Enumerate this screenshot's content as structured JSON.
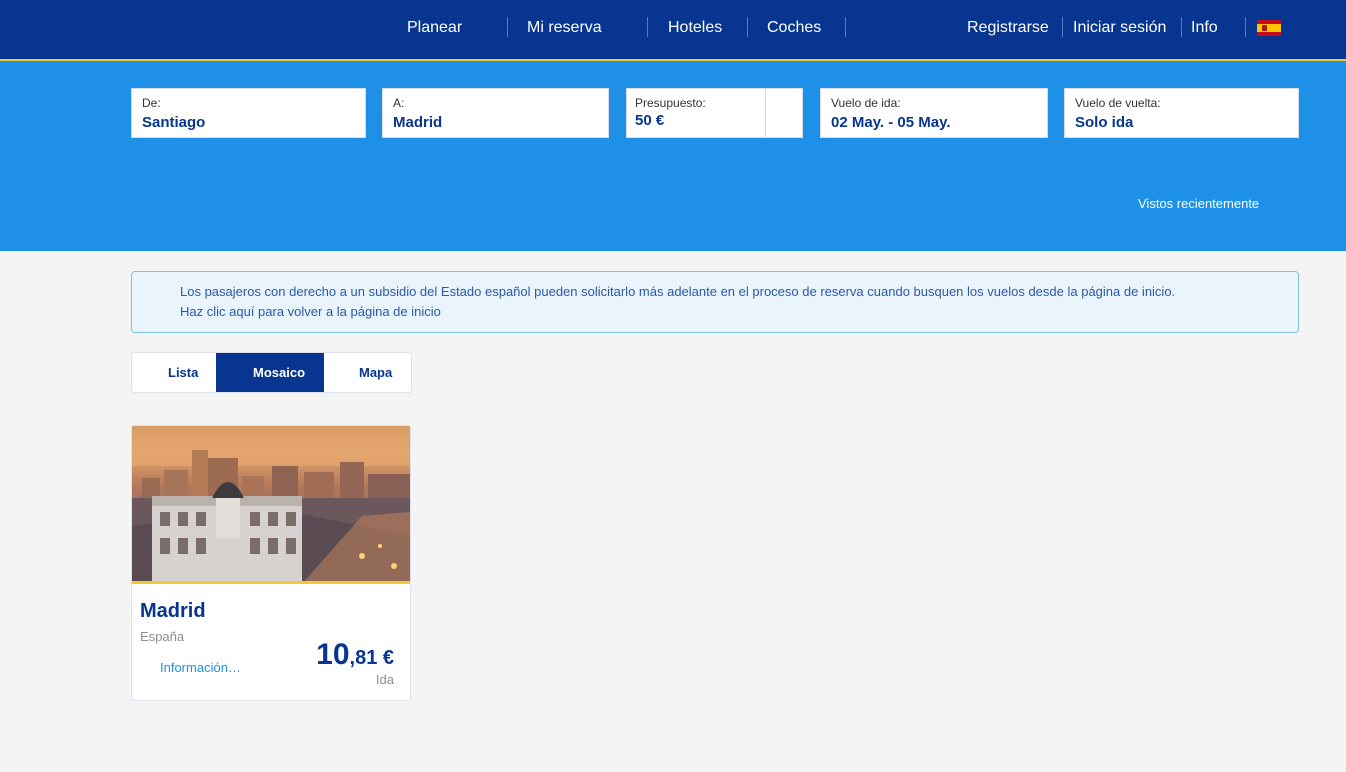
{
  "nav": {
    "plan": "Planear",
    "booking": "Mi reserva",
    "hotels": "Hoteles",
    "cars": "Coches",
    "register": "Registrarse",
    "login": "Iniciar sesión",
    "info": "Info",
    "flag_icon": "spain-flag-icon"
  },
  "search": {
    "from": {
      "label": "De:",
      "value": "Santiago"
    },
    "to": {
      "label": "A:",
      "value": "Madrid"
    },
    "budget": {
      "label": "Presupuesto:",
      "value": "50 €"
    },
    "outbound": {
      "label": "Vuelo de ida:",
      "value": "02 May. - 05 May."
    },
    "return": {
      "label": "Vuelo de vuelta:",
      "value": "Solo ida"
    },
    "recently_viewed": "Vistos recientemente"
  },
  "notice": {
    "line1": "Los pasajeros con derecho a un subsidio del Estado español pueden solicitarlo más adelante en el proceso de reserva cuando busquen los vuelos desde la página de inicio.",
    "line2": "Haz clic aquí para volver a la página de inicio"
  },
  "view_toggle": {
    "list": "Lista",
    "mosaic": "Mosaico",
    "map": "Mapa",
    "active": "Mosaico"
  },
  "result": {
    "city": "Madrid",
    "country": "España",
    "info_link": "Información…",
    "price_int": "10",
    "price_dec": ",81 €",
    "trip_type": "Ida"
  },
  "colors": {
    "nav_bg": "#073590",
    "band_bg": "#1e90e8",
    "accent": "#f1c933"
  }
}
